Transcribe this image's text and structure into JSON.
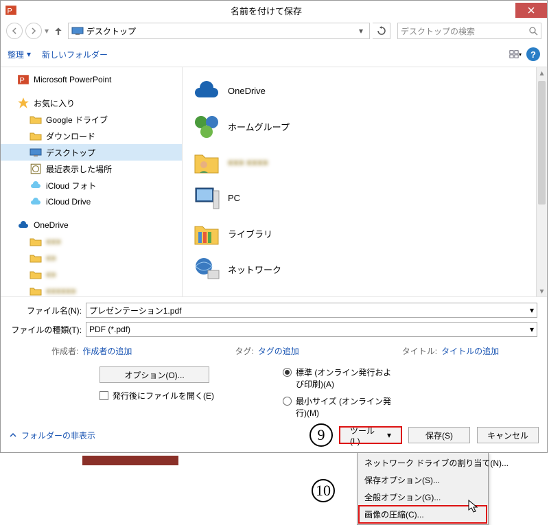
{
  "titlebar": {
    "title": "名前を付けて保存"
  },
  "address": {
    "location": "デスクトップ"
  },
  "search": {
    "placeholder": "デスクトップの検索"
  },
  "toolbar": {
    "organize": "整理",
    "newfolder": "新しいフォルダー"
  },
  "sidebar": {
    "powerpoint": "Microsoft PowerPoint",
    "favorites": "お気に入り",
    "gdrive": "Google ドライブ",
    "downloads": "ダウンロード",
    "desktop": "デスクトップ",
    "recent": "最近表示した場所",
    "icloudphoto": "iCloud フォト",
    "iclouddrive": "iCloud Drive",
    "onedrive": "OneDrive",
    "f1": "■■■",
    "f2": "■■",
    "f3": "■■",
    "f4": "■■■■■■",
    "f5": "■■■ ■■■■■■"
  },
  "files": {
    "onedrive": "OneDrive",
    "homegroup": "ホームグループ",
    "blurname": "■■■ ■■■■",
    "pc": "PC",
    "library": "ライブラリ",
    "network": "ネットワーク"
  },
  "form": {
    "filename_label": "ファイル名(N):",
    "filename_value": "プレゼンテーション1.pdf",
    "filetype_label": "ファイルの種類(T):",
    "filetype_value": "PDF (*.pdf)",
    "author_label": "作成者:",
    "author_value": "作成者の追加",
    "tag_label": "タグ:",
    "tag_value": "タグの追加",
    "title_label": "タイトル:",
    "title_value": "タイトルの追加",
    "options_btn": "オプション(O)...",
    "open_after": "発行後にファイルを開く(E)",
    "radio_standard": "標準 (オンライン発行および印刷)(A)",
    "radio_min": "最小サイズ (オンライン発行)(M)"
  },
  "footer": {
    "hide_folders": "フォルダーの非表示",
    "tools": "ツール(L)",
    "save": "保存(S)",
    "cancel": "キャンセル"
  },
  "menu": {
    "map_drive": "ネットワーク ドライブの割り当て(N)...",
    "save_options": "保存オプション(S)...",
    "general_options": "全般オプション(G)...",
    "compress_images": "画像の圧縮(C)..."
  },
  "annotations": {
    "nine": "9",
    "ten": "10"
  }
}
